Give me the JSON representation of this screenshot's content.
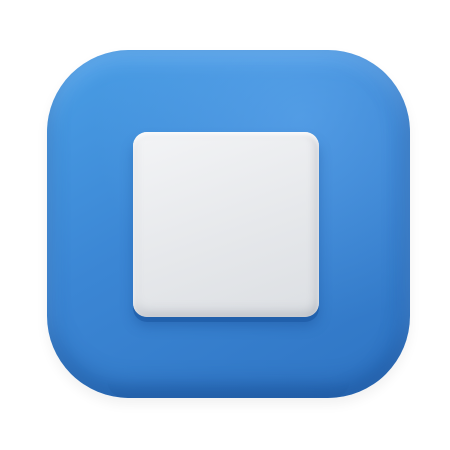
{
  "icon": {
    "name": "stop-button",
    "glyph": "stop-square-icon",
    "colors": {
      "tile": "#3b86d4",
      "tile_highlight": "#4b9fe6",
      "tile_shadow": "#2f74c3",
      "square": "#e6e8eb",
      "background": "#ffffff"
    }
  }
}
